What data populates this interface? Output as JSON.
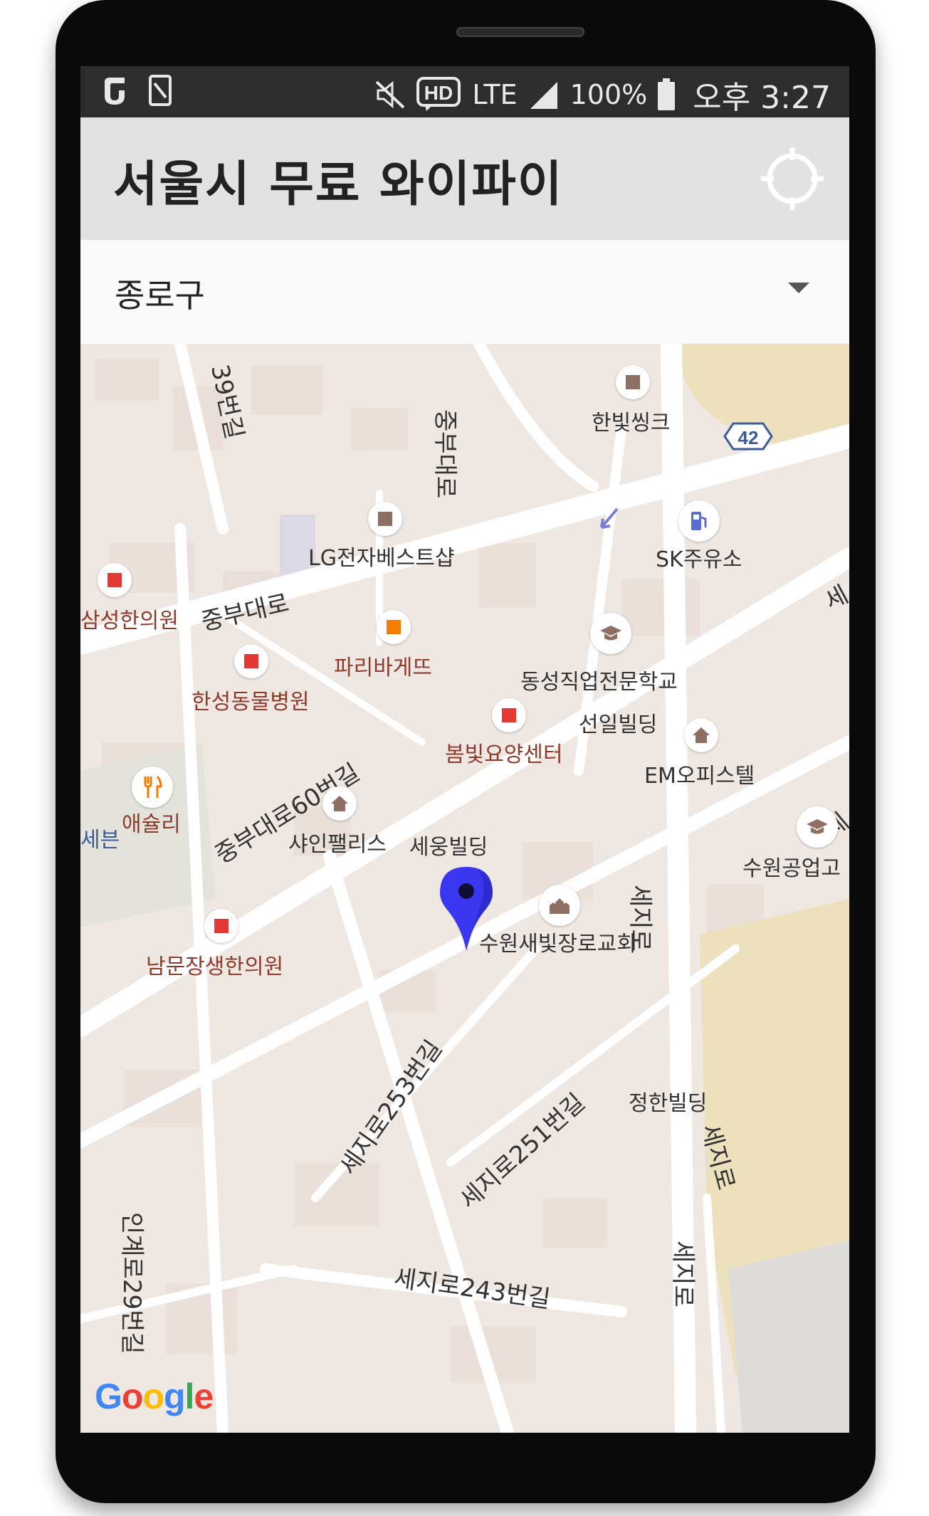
{
  "status_bar": {
    "battery": "100%",
    "time": "오후 3:27",
    "network": "LTE"
  },
  "app": {
    "title": "서울시 무료 와이파이",
    "locate_icon": "crosshair-icon"
  },
  "district_select": {
    "selected": "종로구"
  },
  "map": {
    "provider": "Google",
    "roads": [
      "39번길",
      "중부대로",
      "중부대로",
      "중부대로60번길",
      "세지로253번길",
      "세지로251번길",
      "세지로",
      "세지로",
      "세지로",
      "세지로243번길",
      "인계로29번길",
      "42"
    ],
    "places": [
      {
        "name": "한빛씽크",
        "icon": "store"
      },
      {
        "name": "LG전자베스트샵",
        "icon": "store"
      },
      {
        "name": "SK주유소",
        "icon": "gas-station"
      },
      {
        "name": "삼성한의원",
        "icon": "hospital"
      },
      {
        "name": "파리바게뜨",
        "icon": "bakery"
      },
      {
        "name": "동성직업전문학교",
        "icon": "school"
      },
      {
        "name": "한성동물병원",
        "icon": "hospital"
      },
      {
        "name": "선일빌딩",
        "icon": "building"
      },
      {
        "name": "봄빛요양센터",
        "icon": "hospital"
      },
      {
        "name": "EM오피스텔",
        "icon": "home"
      },
      {
        "name": "애슐리",
        "icon": "restaurant"
      },
      {
        "name": "샤인팰리스",
        "icon": "home"
      },
      {
        "name": "세웅빌딩",
        "icon": "marker"
      },
      {
        "name": "수원공업고",
        "icon": "school"
      },
      {
        "name": "수원새빛장로교회",
        "icon": "church"
      },
      {
        "name": "남문장생한의원",
        "icon": "hospital"
      },
      {
        "name": "정한빌딩",
        "icon": "building"
      },
      {
        "name": "세",
        "icon": "road"
      },
      {
        "name": "세",
        "icon": "road"
      },
      {
        "name": "세븐",
        "icon": "store"
      }
    ]
  }
}
